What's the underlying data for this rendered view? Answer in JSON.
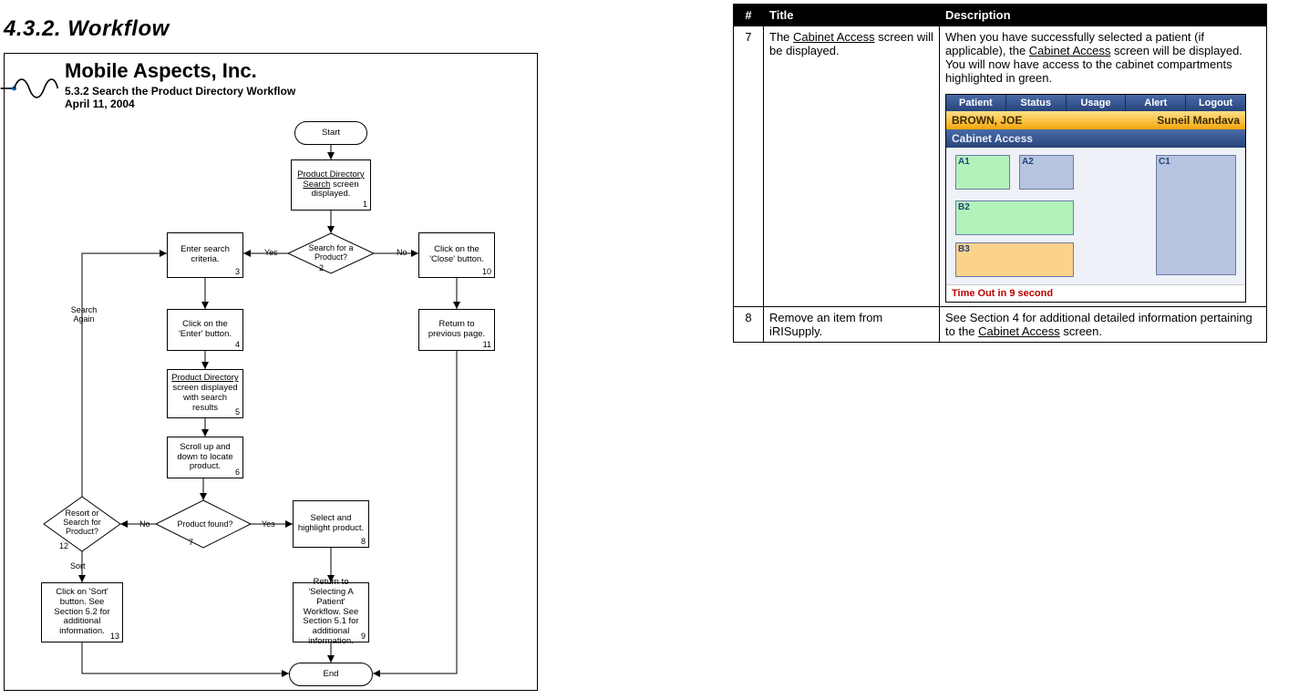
{
  "section_heading": "4.3.2.  Workflow",
  "diagram": {
    "company": "Mobile Aspects, Inc.",
    "subtitle": "5.3.2 Search the Product Directory Workflow",
    "date": "April 11, 2004",
    "start": "Start",
    "end": "End",
    "boxes": {
      "b1_pre": "Product Directory",
      "b1_post": " screen displayed.",
      "b1_mid": "Search",
      "b2": "Search for a Product?",
      "b3": "Enter search criteria.",
      "b4": "Click on the 'Enter' button.",
      "b5_pre": "Product Directory",
      "b5_post": " screen displayed with search results",
      "b6": "Scroll up and down to locate product.",
      "b7": "Product found?",
      "b8": "Select and highlight product.",
      "b9": "Return to 'Selecting A Patient' Workflow. See Section 5.1 for additional information.",
      "b10": "Click on the 'Close' button.",
      "b11": "Return to previous page.",
      "b12": "Resort or Search for Product?",
      "b13": "Click on 'Sort' button. See Section 5.2 for additional information."
    },
    "labels": {
      "yes": "Yes",
      "no": "No",
      "search_again": "Search\nAgain",
      "sort": "Sort"
    }
  },
  "table": {
    "headers": [
      "#",
      "Title",
      "Description"
    ],
    "rows": [
      {
        "num": "7",
        "title_pre": "The ",
        "title_link": "Cabinet Access",
        "title_post": " screen will be displayed.",
        "desc_pre": "When you have successfully selected a patient (if applicable), the ",
        "desc_link": "Cabinet Access",
        "desc_post": " screen will be displayed.  You will now have access to the cabinet compartments highlighted in green."
      },
      {
        "num": "8",
        "title": "Remove an item from iRISupply.",
        "desc_pre": "See Section 4 for additional detailed information pertaining to the ",
        "desc_link": "Cabinet Access",
        "desc_post": " screen."
      }
    ]
  },
  "inset": {
    "tabs": [
      "Patient",
      "Status",
      "Usage",
      "Alert",
      "Logout"
    ],
    "orange_left": "BROWN, JOE",
    "orange_right": "Suneil Mandava",
    "blue_left": "Cabinet Access",
    "compartments": {
      "A1": "A1",
      "A2": "A2",
      "C1": "C1",
      "B2": "B2",
      "B3": "B3"
    },
    "timeout": "Time Out in 9 second"
  }
}
